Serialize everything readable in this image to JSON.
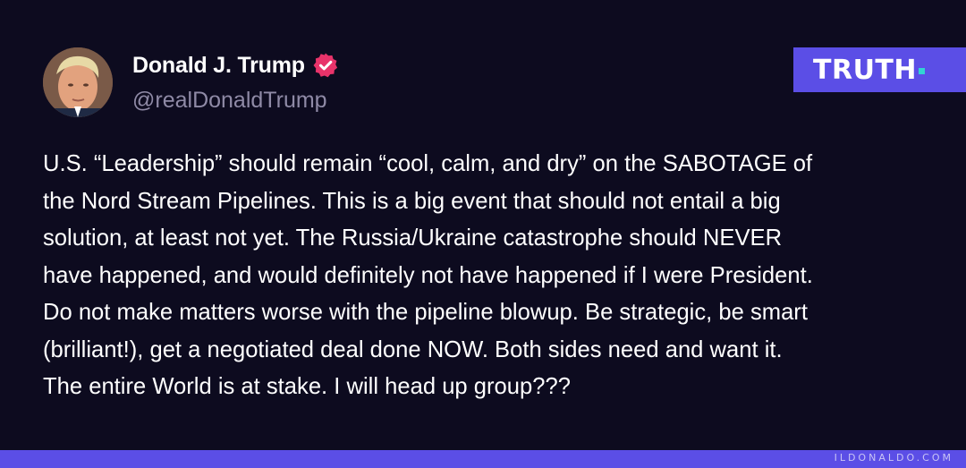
{
  "post": {
    "author": {
      "display_name": "Donald J. Trump",
      "handle": "@realDonaldTrump",
      "verified_icon": "verified-check-badge",
      "avatar": "profile-photo"
    },
    "body_lines": [
      "U.S. “Leadership” should remain “cool, calm, and dry” on the SABOTAGE of",
      "the Nord Stream Pipelines. This is a big event that should not entail a big",
      "solution, at least not yet. The Russia/Ukraine catastrophe should NEVER",
      "have happened, and would definitely not have happened if I were President.",
      "Do not make matters worse with the pipeline blowup. Be strategic, be smart",
      "(brilliant!), get a negotiated deal done NOW. Both sides need and want it.",
      "The entire World is at stake. I will head up group???"
    ]
  },
  "brand": {
    "wordmark": "TRUTH",
    "dot_color": "#32d3d3",
    "badge_color": "#5b4ee6"
  },
  "footer": {
    "watermark": "ILDONALDO.COM"
  },
  "colors": {
    "background": "#0d0b1f",
    "verified": "#e8336a",
    "accent": "#5b4ee6"
  }
}
